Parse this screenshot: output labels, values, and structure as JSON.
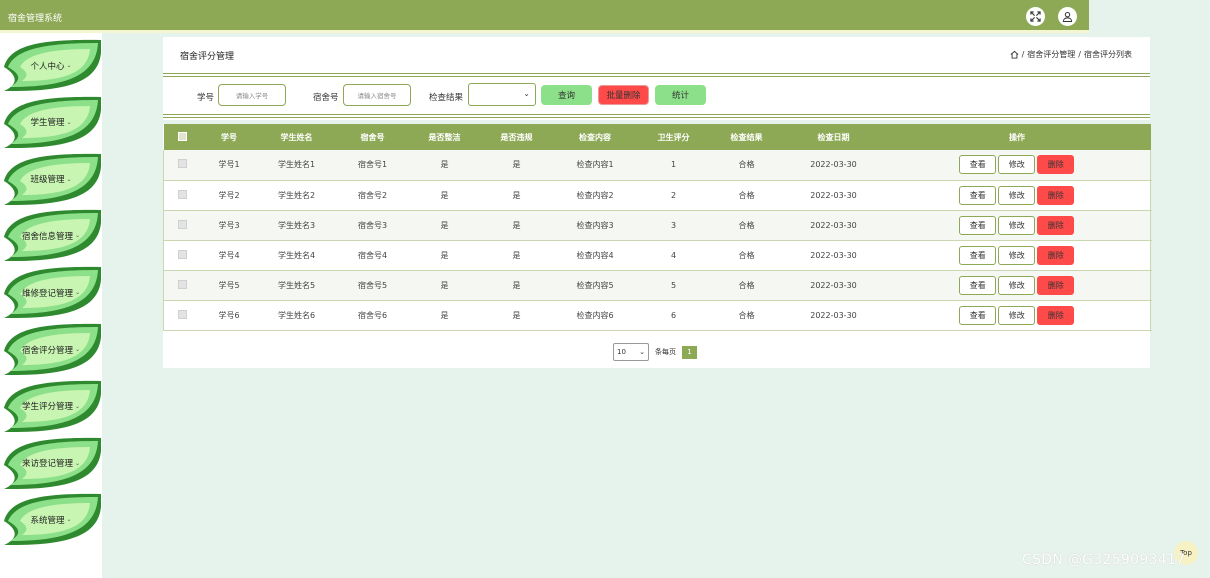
{
  "app": {
    "title": "宿舍管理系统"
  },
  "topbar": {
    "icons": [
      "fullscreen-icon",
      "user-icon"
    ]
  },
  "sidebar": {
    "items": [
      {
        "label": "个人中心",
        "caret": "⌄"
      },
      {
        "label": "学生管理",
        "caret": "⌄"
      },
      {
        "label": "班级管理",
        "caret": "⌄"
      },
      {
        "label": "宿舍信息管理",
        "caret": "⌄"
      },
      {
        "label": "维修登记管理",
        "caret": "⌄"
      },
      {
        "label": "宿舍评分管理",
        "caret": "⌄"
      },
      {
        "label": "学生评分管理",
        "caret": "⌄"
      },
      {
        "label": "来访登记管理",
        "caret": "⌄"
      },
      {
        "label": "系统管理",
        "caret": "⌄"
      }
    ]
  },
  "page": {
    "title": "宿舍评分管理",
    "breadcrumb": {
      "sep": "/",
      "level1": "宿舍评分管理",
      "level2": "宿舍评分列表"
    }
  },
  "search": {
    "student_no_label": "学号",
    "student_no_placeholder": "请输入学号",
    "dorm_no_label": "宿舍号",
    "dorm_no_placeholder": "请输入宿舍号",
    "result_label": "检查结果",
    "result_value": "",
    "query_label": "查询",
    "batch_delete_label": "批量删除",
    "stats_label": "统计"
  },
  "table": {
    "columns": [
      "学号",
      "学生姓名",
      "宿舍号",
      "是否整洁",
      "是否违规",
      "检查内容",
      "卫生评分",
      "检查结果",
      "检查日期",
      "操作"
    ],
    "rows": [
      [
        "学号1",
        "学生姓名1",
        "宿舍号1",
        "是",
        "是",
        "检查内容1",
        "1",
        "合格",
        "2022-03-30"
      ],
      [
        "学号2",
        "学生姓名2",
        "宿舍号2",
        "是",
        "是",
        "检查内容2",
        "2",
        "合格",
        "2022-03-30"
      ],
      [
        "学号3",
        "学生姓名3",
        "宿舍号3",
        "是",
        "是",
        "检查内容3",
        "3",
        "合格",
        "2022-03-30"
      ],
      [
        "学号4",
        "学生姓名4",
        "宿舍号4",
        "是",
        "是",
        "检查内容4",
        "4",
        "合格",
        "2022-03-30"
      ],
      [
        "学号5",
        "学生姓名5",
        "宿舍号5",
        "是",
        "是",
        "检查内容5",
        "5",
        "合格",
        "2022-03-30"
      ],
      [
        "学号6",
        "学生姓名6",
        "宿舍号6",
        "是",
        "是",
        "检查内容6",
        "6",
        "合格",
        "2022-03-30"
      ]
    ],
    "actions": {
      "view": "查看",
      "edit": "修改",
      "delete": "删除"
    }
  },
  "pager": {
    "page_size": "10",
    "per_page_label": "条每页",
    "current_page": "1"
  },
  "misc": {
    "top_label": "Top",
    "watermark": "CSDN @G3259093417"
  },
  "colors": {
    "accent": "#8da955",
    "background": "#e6f2ec",
    "leaf": "#8de08a",
    "danger": "#ff4a4a"
  }
}
